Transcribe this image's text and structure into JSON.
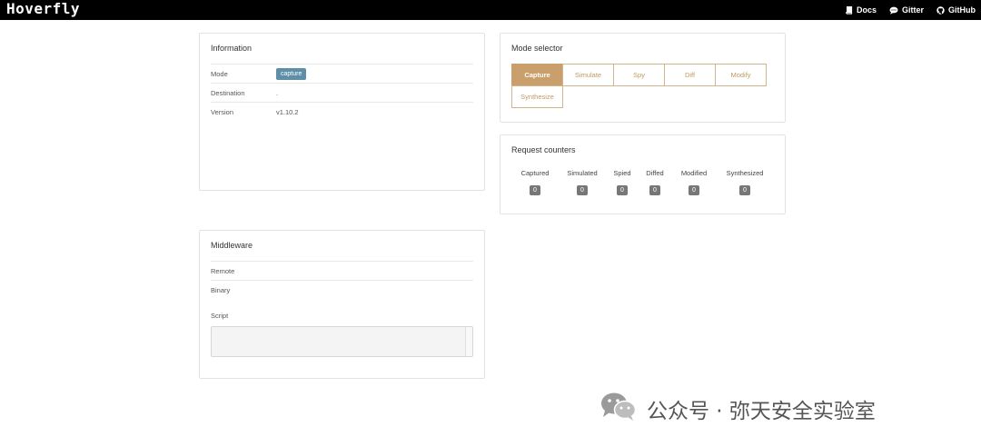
{
  "app": {
    "logo": "Hoverfly"
  },
  "nav": {
    "links": [
      {
        "label": "Docs",
        "icon": "book-icon"
      },
      {
        "label": "Gitter",
        "icon": "chat-icon"
      },
      {
        "label": "GitHub",
        "icon": "github-icon"
      }
    ]
  },
  "information": {
    "title": "Information",
    "rows": [
      {
        "label": "Mode",
        "value": "capture"
      },
      {
        "label": "Destination",
        "value": "."
      },
      {
        "label": "Version",
        "value": "v1.10.2"
      }
    ]
  },
  "middleware": {
    "title": "Middleware",
    "rows": [
      {
        "label": "Remote",
        "value": ""
      },
      {
        "label": "Binary",
        "value": ""
      }
    ],
    "script_label": "Script",
    "script_value": ""
  },
  "mode_selector": {
    "title": "Mode selector",
    "modes": [
      "Capture",
      "Simulate",
      "Spy",
      "Diff",
      "Modify",
      "Synthesize"
    ],
    "active": "Capture"
  },
  "request_counters": {
    "title": "Request counters",
    "items": [
      {
        "label": "Captured",
        "value": "0"
      },
      {
        "label": "Simulated",
        "value": "0"
      },
      {
        "label": "Spied",
        "value": "0"
      },
      {
        "label": "Diffed",
        "value": "0"
      },
      {
        "label": "Modified",
        "value": "0"
      },
      {
        "label": "Synthesized",
        "value": "0"
      }
    ]
  },
  "watermark": {
    "text": "公众号 · 弥天安全实验室"
  },
  "colors": {
    "accent": "#c9a06b",
    "badge": "#5e8fa6",
    "counter_badge": "#777777",
    "topbar": "#000000"
  }
}
